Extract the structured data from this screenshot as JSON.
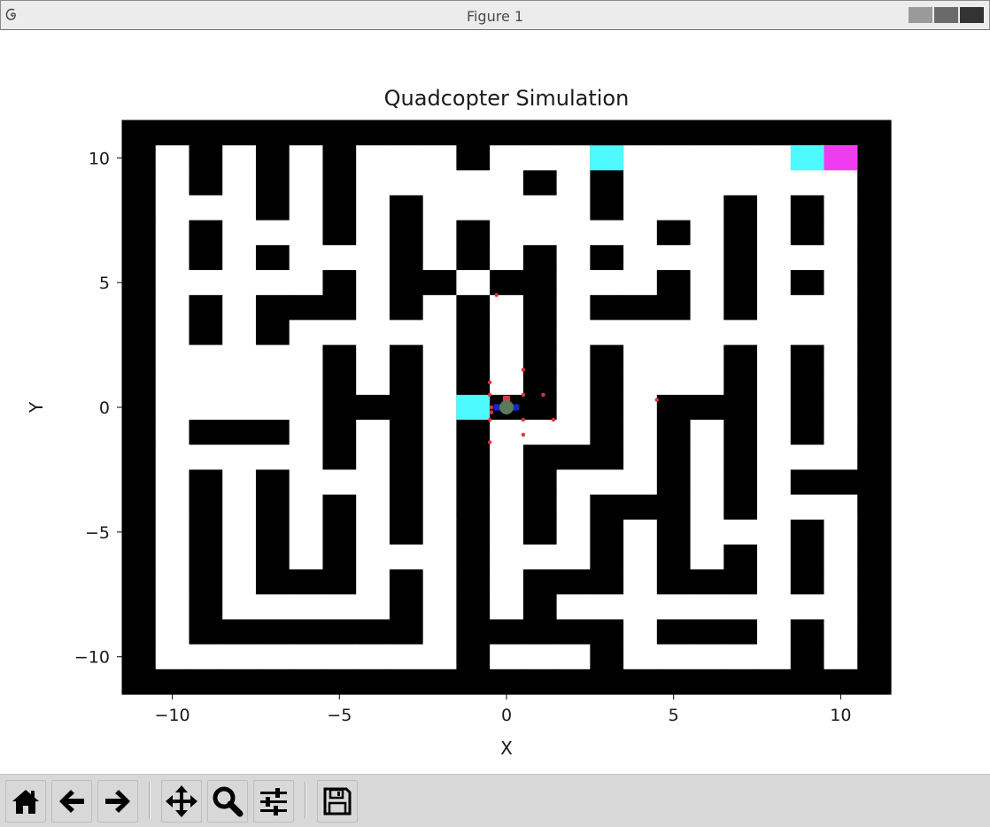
{
  "window": {
    "title": "Figure 1"
  },
  "chart_data": {
    "type": "heatmap",
    "title": "Quadcopter Simulation",
    "xlabel": "X",
    "ylabel": "Y",
    "xlim": [
      -11.5,
      11.5
    ],
    "ylim": [
      -11.5,
      11.5
    ],
    "xticks": [
      -10,
      -5,
      0,
      5,
      10
    ],
    "yticks": [
      -10,
      -5,
      0,
      5,
      10
    ],
    "xtick_labels": [
      "−10",
      "−5",
      "0",
      "5",
      "10"
    ],
    "ytick_labels": [
      "−10",
      "−5",
      "0",
      "5",
      "10"
    ],
    "grid": false,
    "cell_size": 1,
    "colors": {
      "wall": "#000000",
      "free": "#ffffff",
      "goal_cells": "#4dfaff",
      "start_cell": "#f03cf0",
      "waypoints": "#e8323c",
      "drone_arm": "#1428d2",
      "drone_body": "#5a7a5a"
    },
    "maze_rows_top_to_bottom": [
      "#######################",
      "#.#.#.#...#...#.......#",
      "#.#.#.#.....#.#.......#",
      "#...#.#.#.....#...#.#.#",
      "#.#...#.#.#.....#.#.#.#",
      "#.#.#...#.#.#.#...#...#",
      "#.....#.##.##...#.#.#.#",
      "#.#.###.#.#.#.###.#...#",
      "#.#.#.....#.#.........#",
      "#.....#.#.#.#.#...#.#.#",
      "#.....#.#.#.#.#...#.#.#",
      "#.....###.###.#.###.#.#",
      "#.###.#.#.#...#.#.#.#.#",
      "#.....#.#.#.###.#.#...#",
      "#.#.#...#.#.#...#.#.###",
      "#.#.#.#.#.#.#.###.#...#",
      "#.#.#.#.#.#.#.#.#...#.#",
      "#.#.#.#...#...#.#.#.#.#",
      "#.#.###.#.#.###.###.#.#",
      "#.#.....#.#.#.........#",
      "#.#######.#####.###.#.#",
      "#.........#...#.....#.#",
      "#######################"
    ],
    "goal_cells": [
      {
        "x": 3,
        "y": 10
      },
      {
        "x": 9,
        "y": 10
      },
      {
        "x": -1,
        "y": 0
      }
    ],
    "start_cell": {
      "x": 10,
      "y": 10
    },
    "drone": {
      "x": 0,
      "y": 0
    },
    "waypoints": [
      {
        "x": -0.3,
        "y": 4.5
      },
      {
        "x": -0.5,
        "y": 1.0
      },
      {
        "x": -0.5,
        "y": 0.5
      },
      {
        "x": 0.5,
        "y": 1.5
      },
      {
        "x": 0.5,
        "y": 0.5
      },
      {
        "x": 1.1,
        "y": 0.5
      },
      {
        "x": 4.5,
        "y": 0.3
      },
      {
        "x": -0.5,
        "y": -0.5
      },
      {
        "x": -0.5,
        "y": -1.4
      },
      {
        "x": 0.5,
        "y": -0.5
      },
      {
        "x": 0.5,
        "y": -1.1
      },
      {
        "x": 1.4,
        "y": -0.5
      },
      {
        "x": -0.45,
        "y": 0.0
      },
      {
        "x": -0.45,
        "y": -0.2
      }
    ]
  },
  "toolbar": {
    "buttons": [
      {
        "name": "home",
        "icon": "home-icon",
        "tooltip": "Reset original view"
      },
      {
        "name": "back",
        "icon": "arrow-left-icon",
        "tooltip": "Back to previous view"
      },
      {
        "name": "forward",
        "icon": "arrow-right-icon",
        "tooltip": "Forward to next view"
      },
      {
        "name": "pan",
        "icon": "move-icon",
        "tooltip": "Pan axes"
      },
      {
        "name": "zoom",
        "icon": "magnifier-icon",
        "tooltip": "Zoom to rectangle"
      },
      {
        "name": "configure",
        "icon": "sliders-icon",
        "tooltip": "Configure subplots"
      },
      {
        "name": "save",
        "icon": "floppy-disk-icon",
        "tooltip": "Save the figure"
      }
    ]
  }
}
